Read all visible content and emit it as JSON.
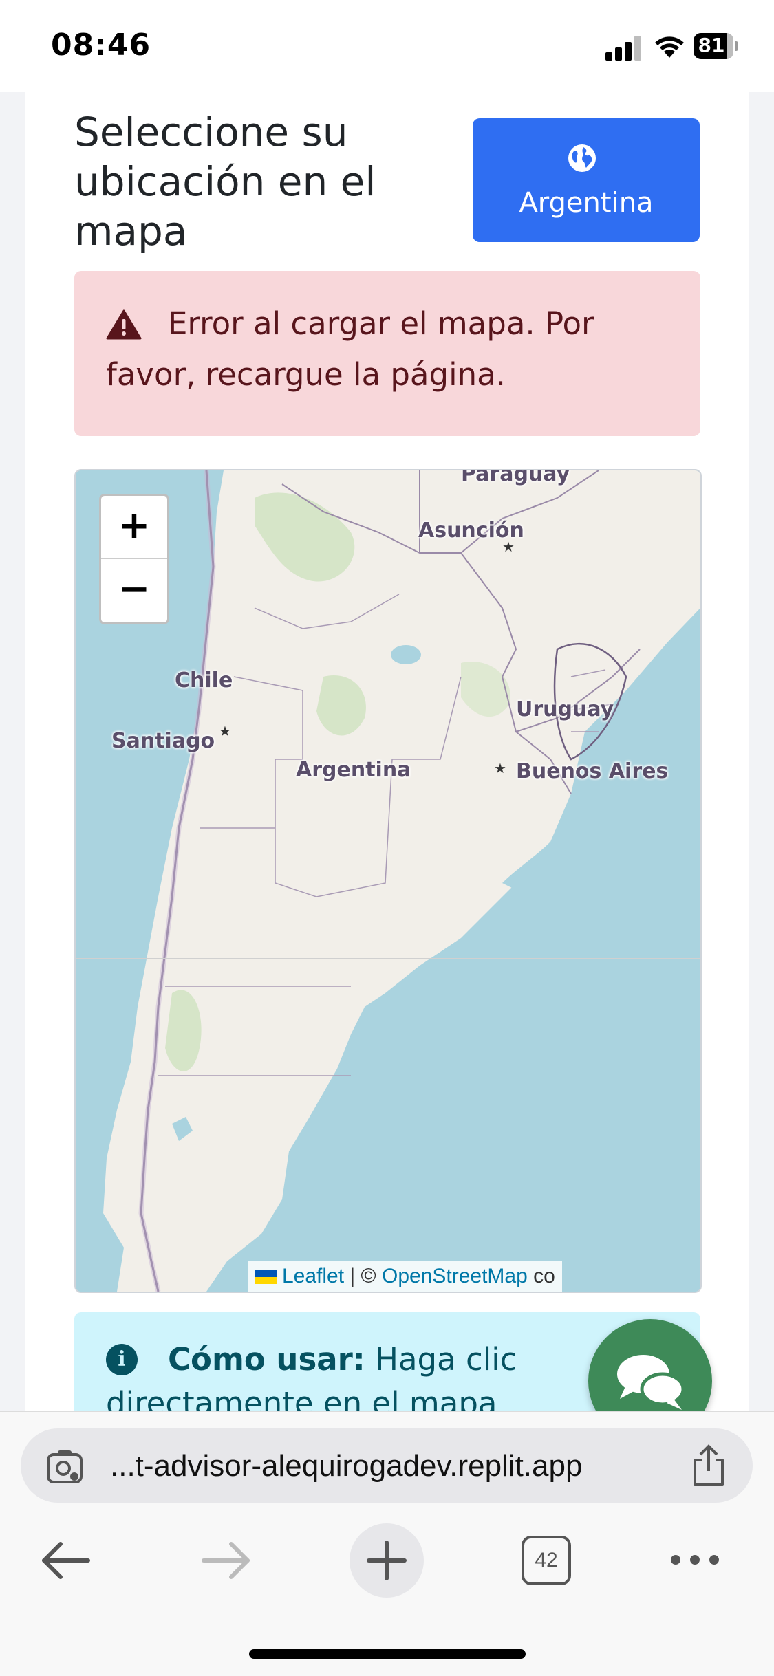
{
  "status": {
    "time": "08:46",
    "battery": "81"
  },
  "page": {
    "title": "Seleccione su ubicación en el mapa",
    "country_button": {
      "label": "Argentina",
      "icon": "globe-icon",
      "color": "#2f6ef2"
    },
    "error_alert": {
      "icon": "warning-icon",
      "message": "Error al cargar el mapa. Por favor, recargue la página.",
      "color": "#f8d7da"
    },
    "map": {
      "zoom_in": "+",
      "zoom_out": "−",
      "labels": {
        "paraguay": "Paraguay",
        "asuncion": "Asunción",
        "chile": "Chile",
        "santiago": "Santiago",
        "argentina": "Argentina",
        "uruguay": "Uruguay",
        "buenos_aires": "Buenos Aires"
      },
      "attribution": {
        "leaflet": "Leaflet",
        "sep": " | © ",
        "osm": "OpenStreetMap",
        "tail": " co"
      }
    },
    "info_alert": {
      "icon": "info-icon",
      "bold": "Cómo usar:",
      "text": " Haga clic",
      "text2": "directamente en el mapa",
      "color": "#cff4fc"
    },
    "chat_button": {
      "icon": "chat-bubbles-icon",
      "color": "#3e8a58"
    }
  },
  "browser": {
    "url": "...t-advisor-alequirogadev.replit.app",
    "tab_count": "42"
  }
}
